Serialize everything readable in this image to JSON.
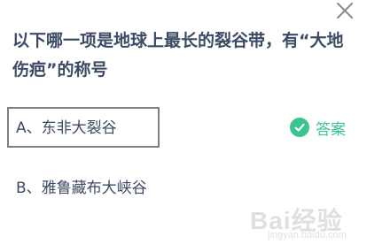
{
  "question": {
    "text": "以下哪一项是地球上最长的裂谷带，有“大地伤疤”的称号"
  },
  "options": [
    {
      "label": "A、东非大裂谷",
      "selected": true
    },
    {
      "label": "B、雅鲁藏布大峡谷",
      "selected": false
    }
  ],
  "answer_tag": {
    "label": "答案",
    "icon": "check-circle-icon",
    "color": "#3cc48e"
  },
  "close_icon": "close-icon",
  "watermark": {
    "brand": "Bai经验",
    "url": "jingyan.baidu.com"
  },
  "colors": {
    "question_text": "#3d4a66",
    "selected_border": "#808080",
    "answer_green": "#3cc48e"
  }
}
